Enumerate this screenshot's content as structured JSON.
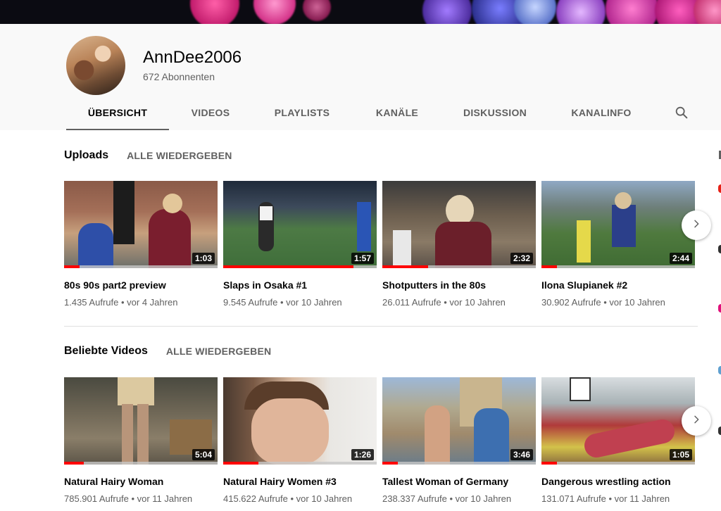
{
  "channel": {
    "name": "AnnDee2006",
    "subscribers": "672 Abonnenten"
  },
  "tabs": [
    {
      "label": "ÜBERSICHT",
      "active": true
    },
    {
      "label": "VIDEOS",
      "active": false
    },
    {
      "label": "PLAYLISTS",
      "active": false
    },
    {
      "label": "KANÄLE",
      "active": false
    },
    {
      "label": "DISKUSSION",
      "active": false
    },
    {
      "label": "KANALINFO",
      "active": false
    }
  ],
  "search_icon": "search-icon",
  "sections": [
    {
      "title": "Uploads",
      "play_all": "ALLE WIEDERGEBEN",
      "videos": [
        {
          "title": "80s 90s part2 preview",
          "views": "1.435 Aufrufe",
          "age": "vor 4 Jahren",
          "duration": "1:03",
          "progress": 0.1
        },
        {
          "title": "Slaps in Osaka #1",
          "views": "9.545 Aufrufe",
          "age": "vor 10 Jahren",
          "duration": "1:57",
          "progress": 0.85
        },
        {
          "title": "Shotputters in the 80s",
          "views": "26.011 Aufrufe",
          "age": "vor 10 Jahren",
          "duration": "2:32",
          "progress": 0.3
        },
        {
          "title": "Ilona Slupianek #2",
          "views": "30.902 Aufrufe",
          "age": "vor 10 Jahren",
          "duration": "2:44",
          "progress": 0.1
        }
      ]
    },
    {
      "title": "Beliebte Videos",
      "play_all": "ALLE WIEDERGEBEN",
      "videos": [
        {
          "title": "Natural Hairy Woman",
          "views": "785.901 Aufrufe",
          "age": "vor 11 Jahren",
          "duration": "5:04",
          "progress": 0.13
        },
        {
          "title": "Natural Hairy Women #3",
          "views": "415.622 Aufrufe",
          "age": "vor 10 Jahren",
          "duration": "1:26",
          "progress": 0.23
        },
        {
          "title": "Tallest Woman of Germany",
          "views": "238.337 Aufrufe",
          "age": "vor 10 Jahren",
          "duration": "3:46",
          "progress": 0.1
        },
        {
          "title": "Dangerous wrestling action",
          "views": "131.071 Aufrufe",
          "age": "vor 11 Jahren",
          "duration": "1:05",
          "progress": 0.1
        }
      ]
    }
  ],
  "meta_separator": "•",
  "next_icon": "chevron-right-icon"
}
